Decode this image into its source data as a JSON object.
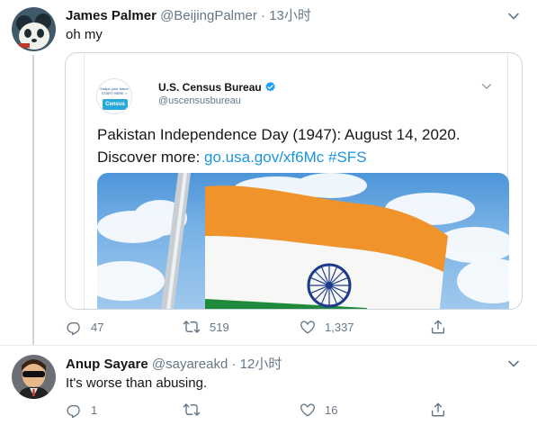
{
  "tweets": [
    {
      "name": "James Palmer",
      "handle": "@BeijingPalmer",
      "separator": "·",
      "time": "13小时",
      "text": "oh my",
      "quote": {
        "account_name": "U.S. Census Bureau",
        "account_handle": "@uscensusbureau",
        "logo_top_text": "Shape your future START HERE >",
        "logo_badge_text": "Census 2020",
        "body_prefix": "Pakistan Independence Day (1947): August 14, 2020. Discover more: ",
        "body_link": "go.usa.gov/xf6Mc",
        "body_hashtag": "#SFS",
        "photo_subject": "flag-photo"
      },
      "stats": {
        "replies": "47",
        "retweets": "519",
        "likes": "1,337"
      }
    },
    {
      "name": "Anup Sayare",
      "handle": "@sayareakd",
      "separator": "·",
      "time": "12小时",
      "text": "It's worse than abusing.",
      "stats": {
        "replies": "1",
        "retweets": "",
        "likes": "16"
      }
    }
  ],
  "colors": {
    "text_primary": "#14171a",
    "text_secondary": "#657786",
    "link": "#1b95e0",
    "border": "#ccd6dd",
    "verified": "#1da1f2",
    "flag_saffron": "#f0932b",
    "flag_green": "#1f8a3b",
    "flag_chakra": "#1e3a8a"
  },
  "icons": {
    "reply": "speech-bubble",
    "retweet": "two-arrows-loop",
    "like": "heart-outline",
    "share": "upload-arrow",
    "caret": "chevron-down",
    "verified": "blue-badge-check"
  }
}
